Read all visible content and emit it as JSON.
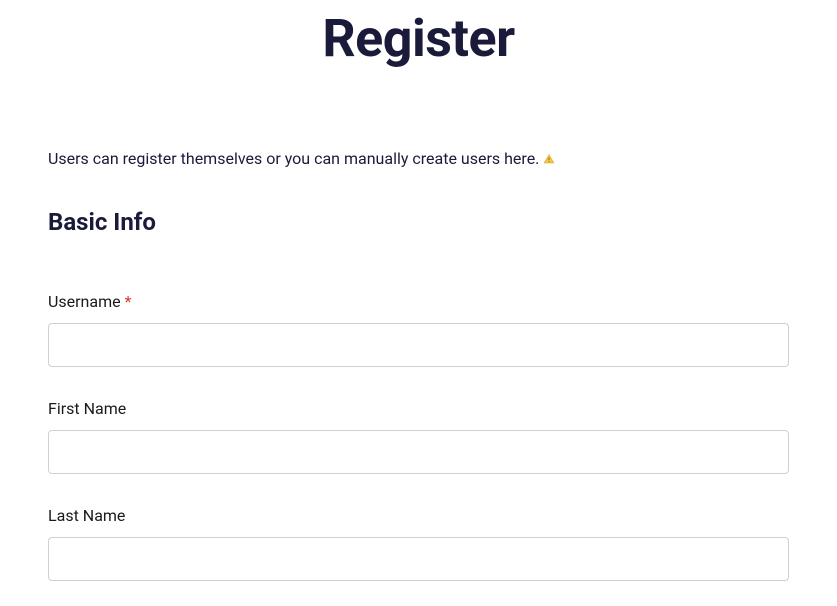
{
  "page": {
    "title": "Register"
  },
  "intro": {
    "text": "Users can register themselves or you can manually create users here."
  },
  "section": {
    "heading": "Basic Info"
  },
  "form": {
    "username": {
      "label": "Username ",
      "required_marker": "*",
      "value": ""
    },
    "first_name": {
      "label": "First Name",
      "value": ""
    },
    "last_name": {
      "label": "Last Name",
      "value": ""
    }
  }
}
